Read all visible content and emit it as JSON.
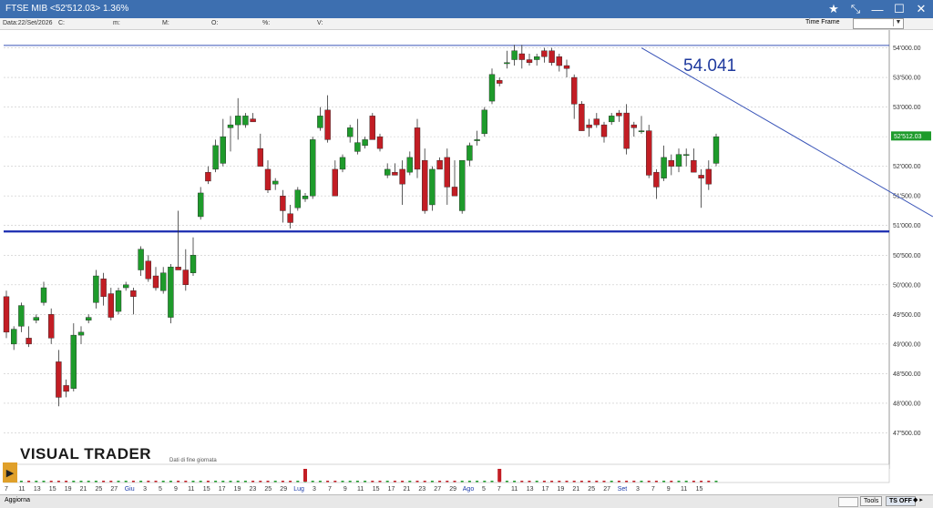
{
  "window": {
    "title": "FTSE MIB <52'512.03> 1.36%",
    "controls": [
      "★",
      "⤡",
      "—",
      "☐",
      "✕"
    ]
  },
  "infobar": {
    "date_label": "Data:22/Set/2026",
    "c_label": "C:",
    "m_label": "m:",
    "M_label": "M:",
    "o_label": "O:",
    "pct_label": "%:",
    "v_label": "V:",
    "time_frame_label": "Time Frame",
    "time_frame_btn": "▼"
  },
  "annotation": {
    "big_value": "54.041"
  },
  "logo": {
    "name": "VISUAL TRADER",
    "sub": "Dati di fine giornata"
  },
  "bottombar": {
    "aggiorna": "Aggiorna",
    "tools": "Tools",
    "ts_off": "TS OFF",
    "arrows": "◆ ▸"
  },
  "colors": {
    "up": "#1e9b2b",
    "down": "#c21d24",
    "trendline": "#3a55b8",
    "support": "#1a2bb0",
    "resistance": "#3a55b8",
    "grid": "#c8c8c8",
    "price_tag": "#1e9b2b"
  },
  "chart_data": {
    "type": "candlestick",
    "ylim": [
      47200,
      54300
    ],
    "y_ticks": [
      "54'000.00",
      "53'500.00",
      "53'000.00",
      "52'500.00",
      "52'000.00",
      "51'500.00",
      "51'000.00",
      "50'500.00",
      "50'000.00",
      "49'500.00",
      "49'000.00",
      "48'500.00",
      "48'000.00",
      "47'500.00"
    ],
    "y_tick_values": [
      54000,
      53500,
      53000,
      52500,
      52000,
      51500,
      51000,
      50500,
      50000,
      49500,
      49000,
      48500,
      48000,
      47500
    ],
    "x_labels": [
      "7",
      "11",
      "13",
      "15",
      "19",
      "21",
      "25",
      "27",
      "Giu",
      "3",
      "5",
      "9",
      "11",
      "15",
      "17",
      "19",
      "23",
      "25",
      "29",
      "Lug",
      "3",
      "7",
      "9",
      "11",
      "15",
      "17",
      "21",
      "23",
      "27",
      "29",
      "Ago",
      "5",
      "7",
      "11",
      "13",
      "17",
      "19",
      "21",
      "25",
      "27",
      "Set",
      "3",
      "7",
      "9",
      "11",
      "15"
    ],
    "last_price_label": "52'512.03",
    "last_price": 52512.03,
    "support_level": 50900,
    "resistance_level": 54041,
    "trendline": [
      {
        "i": 85,
        "v": 54000
      },
      {
        "i": 124,
        "v": 51150
      }
    ],
    "candles": [
      {
        "o": 49800,
        "h": 49900,
        "l": 49100,
        "c": 49200
      },
      {
        "o": 49000,
        "h": 49300,
        "l": 48900,
        "c": 49250
      },
      {
        "o": 49300,
        "h": 49700,
        "l": 49200,
        "c": 49650
      },
      {
        "o": 49100,
        "h": 49300,
        "l": 48950,
        "c": 49000
      },
      {
        "o": 49400,
        "h": 49500,
        "l": 49350,
        "c": 49450
      },
      {
        "o": 49700,
        "h": 50050,
        "l": 49650,
        "c": 49950
      },
      {
        "o": 49500,
        "h": 49600,
        "l": 49000,
        "c": 49100
      },
      {
        "o": 48700,
        "h": 48900,
        "l": 47950,
        "c": 48100
      },
      {
        "o": 48300,
        "h": 48400,
        "l": 48100,
        "c": 48200
      },
      {
        "o": 48250,
        "h": 49350,
        "l": 48200,
        "c": 49150
      },
      {
        "o": 49150,
        "h": 49300,
        "l": 49000,
        "c": 49200
      },
      {
        "o": 49400,
        "h": 49500,
        "l": 49350,
        "c": 49450
      },
      {
        "o": 49700,
        "h": 50250,
        "l": 49600,
        "c": 50150
      },
      {
        "o": 50100,
        "h": 50200,
        "l": 49650,
        "c": 49800
      },
      {
        "o": 49850,
        "h": 49950,
        "l": 49400,
        "c": 49450
      },
      {
        "o": 49550,
        "h": 49950,
        "l": 49500,
        "c": 49900
      },
      {
        "o": 49950,
        "h": 50050,
        "l": 49900,
        "c": 50000
      },
      {
        "o": 49900,
        "h": 49950,
        "l": 49500,
        "c": 49800
      },
      {
        "o": 50250,
        "h": 50650,
        "l": 50150,
        "c": 50600
      },
      {
        "o": 50400,
        "h": 50500,
        "l": 50050,
        "c": 50100
      },
      {
        "o": 50150,
        "h": 50300,
        "l": 49900,
        "c": 49950
      },
      {
        "o": 49900,
        "h": 50300,
        "l": 49850,
        "c": 50200
      },
      {
        "o": 49450,
        "h": 50350,
        "l": 49350,
        "c": 50300
      },
      {
        "o": 50300,
        "h": 51250,
        "l": 50250,
        "c": 50250
      },
      {
        "o": 50250,
        "h": 50600,
        "l": 49900,
        "c": 50000
      },
      {
        "o": 50200,
        "h": 50800,
        "l": 50150,
        "c": 50500
      },
      {
        "o": 51150,
        "h": 51650,
        "l": 51100,
        "c": 51550
      },
      {
        "o": 51900,
        "h": 52000,
        "l": 51700,
        "c": 51750
      },
      {
        "o": 51950,
        "h": 52450,
        "l": 51900,
        "c": 52350
      },
      {
        "o": 52050,
        "h": 52800,
        "l": 52000,
        "c": 52500
      },
      {
        "o": 52650,
        "h": 52850,
        "l": 52250,
        "c": 52700
      },
      {
        "o": 52700,
        "h": 53150,
        "l": 52450,
        "c": 52850
      },
      {
        "o": 52700,
        "h": 52900,
        "l": 52650,
        "c": 52850
      },
      {
        "o": 52800,
        "h": 52900,
        "l": 52750,
        "c": 52750
      },
      {
        "o": 52300,
        "h": 52550,
        "l": 52150,
        "c": 52000
      },
      {
        "o": 51950,
        "h": 52100,
        "l": 51550,
        "c": 51600
      },
      {
        "o": 51700,
        "h": 51800,
        "l": 51600,
        "c": 51750
      },
      {
        "o": 51500,
        "h": 51600,
        "l": 51050,
        "c": 51250
      },
      {
        "o": 51200,
        "h": 51350,
        "l": 50950,
        "c": 51050
      },
      {
        "o": 51300,
        "h": 51650,
        "l": 51250,
        "c": 51600
      },
      {
        "o": 51450,
        "h": 51550,
        "l": 51400,
        "c": 51500
      },
      {
        "o": 51500,
        "h": 52500,
        "l": 51450,
        "c": 52450
      },
      {
        "o": 52650,
        "h": 53000,
        "l": 52600,
        "c": 52850
      },
      {
        "o": 52950,
        "h": 53200,
        "l": 52400,
        "c": 52450
      },
      {
        "o": 51950,
        "h": 52100,
        "l": 51500,
        "c": 51500
      },
      {
        "o": 51950,
        "h": 52200,
        "l": 51900,
        "c": 52150
      },
      {
        "o": 52500,
        "h": 52700,
        "l": 52400,
        "c": 52650
      },
      {
        "o": 52250,
        "h": 52800,
        "l": 52200,
        "c": 52400
      },
      {
        "o": 52350,
        "h": 52500,
        "l": 52300,
        "c": 52450
      },
      {
        "o": 52850,
        "h": 52900,
        "l": 52750,
        "c": 52450
      },
      {
        "o": 52500,
        "h": 52550,
        "l": 52250,
        "c": 52300
      },
      {
        "o": 51850,
        "h": 52050,
        "l": 51800,
        "c": 51950
      },
      {
        "o": 51900,
        "h": 52050,
        "l": 51850,
        "c": 51850
      },
      {
        "o": 51950,
        "h": 52100,
        "l": 51350,
        "c": 51700
      },
      {
        "o": 51900,
        "h": 52250,
        "l": 51850,
        "c": 52150
      },
      {
        "o": 52650,
        "h": 52800,
        "l": 51800,
        "c": 51950
      },
      {
        "o": 52100,
        "h": 52300,
        "l": 51200,
        "c": 51250
      },
      {
        "o": 51350,
        "h": 52000,
        "l": 51250,
        "c": 51950
      },
      {
        "o": 52100,
        "h": 52150,
        "l": 52000,
        "c": 51950
      },
      {
        "o": 52150,
        "h": 52300,
        "l": 51350,
        "c": 51650
      },
      {
        "o": 51650,
        "h": 52100,
        "l": 51600,
        "c": 51500
      },
      {
        "o": 51250,
        "h": 51500,
        "l": 51200,
        "c": 52100
      },
      {
        "o": 52100,
        "h": 52400,
        "l": 52000,
        "c": 52350
      },
      {
        "o": 52450,
        "h": 52600,
        "l": 52350,
        "c": 52450
      },
      {
        "o": 52550,
        "h": 53000,
        "l": 52500,
        "c": 52950
      },
      {
        "o": 53100,
        "h": 53650,
        "l": 53050,
        "c": 53550
      },
      {
        "o": 53450,
        "h": 53500,
        "l": 53350,
        "c": 53400
      },
      {
        "o": 53750,
        "h": 53950,
        "l": 53650,
        "c": 53750
      },
      {
        "o": 53800,
        "h": 54050,
        "l": 53700,
        "c": 53950
      },
      {
        "o": 53900,
        "h": 54050,
        "l": 53650,
        "c": 53800
      },
      {
        "o": 53800,
        "h": 53900,
        "l": 53700,
        "c": 53750
      },
      {
        "o": 53800,
        "h": 53900,
        "l": 53700,
        "c": 53850
      },
      {
        "o": 53950,
        "h": 54000,
        "l": 53750,
        "c": 53850
      },
      {
        "o": 53950,
        "h": 54000,
        "l": 53700,
        "c": 53750
      },
      {
        "o": 53850,
        "h": 53900,
        "l": 53600,
        "c": 53700
      },
      {
        "o": 53700,
        "h": 53800,
        "l": 53500,
        "c": 53650
      },
      {
        "o": 53500,
        "h": 53550,
        "l": 52800,
        "c": 53050
      },
      {
        "o": 53050,
        "h": 53100,
        "l": 52600,
        "c": 52600
      },
      {
        "o": 52700,
        "h": 52800,
        "l": 52500,
        "c": 52650
      },
      {
        "o": 52800,
        "h": 52900,
        "l": 52650,
        "c": 52700
      },
      {
        "o": 52700,
        "h": 52750,
        "l": 52400,
        "c": 52500
      },
      {
        "o": 52750,
        "h": 52900,
        "l": 52700,
        "c": 52850
      },
      {
        "o": 52900,
        "h": 52950,
        "l": 52750,
        "c": 52850
      },
      {
        "o": 52900,
        "h": 53050,
        "l": 52200,
        "c": 52300
      },
      {
        "o": 52700,
        "h": 52750,
        "l": 52500,
        "c": 52650
      },
      {
        "o": 52600,
        "h": 52850,
        "l": 52550,
        "c": 52600
      },
      {
        "o": 52600,
        "h": 52700,
        "l": 51800,
        "c": 51850
      },
      {
        "o": 51900,
        "h": 51950,
        "l": 51450,
        "c": 51650
      },
      {
        "o": 51800,
        "h": 52350,
        "l": 51750,
        "c": 52150
      },
      {
        "o": 52100,
        "h": 52200,
        "l": 51850,
        "c": 52000
      },
      {
        "o": 52000,
        "h": 52300,
        "l": 51900,
        "c": 52200
      },
      {
        "o": 52200,
        "h": 52300,
        "l": 52000,
        "c": 52200
      },
      {
        "o": 52100,
        "h": 52300,
        "l": 51950,
        "c": 51900
      },
      {
        "o": 51850,
        "h": 51950,
        "l": 51300,
        "c": 51800
      },
      {
        "o": 51950,
        "h": 52100,
        "l": 51600,
        "c": 51700
      },
      {
        "o": 52050,
        "h": 52550,
        "l": 52000,
        "c": 52500
      }
    ]
  }
}
